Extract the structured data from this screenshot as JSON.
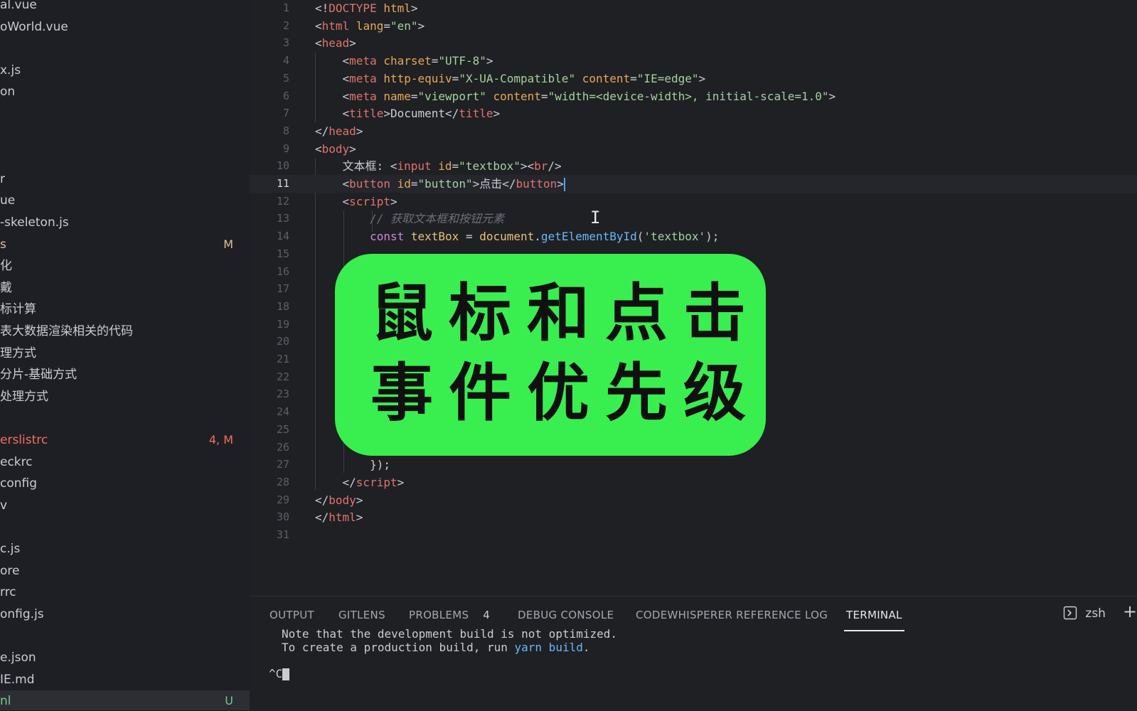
{
  "sidebar": {
    "items": [
      {
        "name": "al.vue",
        "badge": "",
        "state": ""
      },
      {
        "name": "oWorld.vue",
        "badge": "",
        "state": ""
      },
      {
        "name": "",
        "badge": "",
        "state": ""
      },
      {
        "name": "x.js",
        "badge": "",
        "state": ""
      },
      {
        "name": "on",
        "badge": "",
        "state": ""
      },
      {
        "name": "",
        "badge": "",
        "state": ""
      },
      {
        "name": "",
        "badge": "",
        "state": ""
      },
      {
        "name": "",
        "badge": "",
        "state": ""
      },
      {
        "name": "r",
        "badge": "",
        "state": ""
      },
      {
        "name": "ue",
        "badge": "",
        "state": ""
      },
      {
        "name": "-skeleton.js",
        "badge": "",
        "state": ""
      },
      {
        "name": "s",
        "badge": "M",
        "state": "mod"
      },
      {
        "name": "化",
        "badge": "",
        "state": ""
      },
      {
        "name": "戴",
        "badge": "",
        "state": ""
      },
      {
        "name": "标计算",
        "badge": "",
        "state": ""
      },
      {
        "name": "表大数据渲染相关的代码",
        "badge": "",
        "state": ""
      },
      {
        "name": "理方式",
        "badge": "",
        "state": ""
      },
      {
        "name": "分片-基础方式",
        "badge": "",
        "state": ""
      },
      {
        "name": "处理方式",
        "badge": "",
        "state": ""
      },
      {
        "name": "",
        "badge": "",
        "state": ""
      },
      {
        "name": "erslistrc",
        "badge": "4, M",
        "state": "err"
      },
      {
        "name": "eckrc",
        "badge": "",
        "state": ""
      },
      {
        "name": "config",
        "badge": "",
        "state": ""
      },
      {
        "name": "v",
        "badge": "",
        "state": ""
      },
      {
        "name": "",
        "badge": "",
        "state": ""
      },
      {
        "name": "c.js",
        "badge": "",
        "state": ""
      },
      {
        "name": "ore",
        "badge": "",
        "state": ""
      },
      {
        "name": "rrc",
        "badge": "",
        "state": ""
      },
      {
        "name": "onfig.js",
        "badge": "",
        "state": ""
      },
      {
        "name": "",
        "badge": "",
        "state": ""
      },
      {
        "name": "e.json",
        "badge": "",
        "state": ""
      },
      {
        "name": "IE.md",
        "badge": "",
        "state": ""
      },
      {
        "name": "nl",
        "badge": "U",
        "state": "untracked"
      }
    ]
  },
  "editor": {
    "active_line": 11,
    "lines": [
      {
        "n": "1",
        "tokens": [
          [
            "p",
            "<!"
          ],
          [
            "dt",
            "DOCTYPE"
          ],
          [
            "p",
            " "
          ],
          [
            "attr",
            "html"
          ],
          [
            "p",
            ">"
          ]
        ]
      },
      {
        "n": "2",
        "tokens": [
          [
            "p",
            "<"
          ],
          [
            "tag",
            "html"
          ],
          [
            "p",
            " "
          ],
          [
            "attr",
            "lang"
          ],
          [
            "p",
            "="
          ],
          [
            "str",
            "\"en\""
          ],
          [
            "p",
            ">"
          ]
        ]
      },
      {
        "n": "3",
        "tokens": [
          [
            "p",
            "<"
          ],
          [
            "tag",
            "head"
          ],
          [
            "p",
            ">"
          ]
        ]
      },
      {
        "n": "4",
        "tokens": [
          [
            "p",
            "    <"
          ],
          [
            "tag",
            "meta"
          ],
          [
            "p",
            " "
          ],
          [
            "attr",
            "charset"
          ],
          [
            "p",
            "="
          ],
          [
            "str",
            "\"UTF-8\""
          ],
          [
            "p",
            ">"
          ]
        ]
      },
      {
        "n": "5",
        "tokens": [
          [
            "p",
            "    <"
          ],
          [
            "tag",
            "meta"
          ],
          [
            "p",
            " "
          ],
          [
            "attr",
            "http-equiv"
          ],
          [
            "p",
            "="
          ],
          [
            "str",
            "\"X-UA-Compatible\""
          ],
          [
            "p",
            " "
          ],
          [
            "attr",
            "content"
          ],
          [
            "p",
            "="
          ],
          [
            "str",
            "\"IE=edge\""
          ],
          [
            "p",
            ">"
          ]
        ]
      },
      {
        "n": "6",
        "tokens": [
          [
            "p",
            "    <"
          ],
          [
            "tag",
            "meta"
          ],
          [
            "p",
            " "
          ],
          [
            "attr",
            "name"
          ],
          [
            "p",
            "="
          ],
          [
            "str",
            "\"viewport\""
          ],
          [
            "p",
            " "
          ],
          [
            "attr",
            "content"
          ],
          [
            "p",
            "="
          ],
          [
            "str",
            "\"width=<device-width>, initial-scale=1.0\""
          ],
          [
            "p",
            ">"
          ]
        ]
      },
      {
        "n": "7",
        "tokens": [
          [
            "p",
            "    <"
          ],
          [
            "tag",
            "title"
          ],
          [
            "p",
            ">"
          ],
          [
            "txt",
            "Document"
          ],
          [
            "p",
            "</"
          ],
          [
            "tag",
            "title"
          ],
          [
            "p",
            ">"
          ]
        ]
      },
      {
        "n": "8",
        "tokens": [
          [
            "p",
            "</"
          ],
          [
            "tag",
            "head"
          ],
          [
            "p",
            ">"
          ]
        ]
      },
      {
        "n": "9",
        "tokens": [
          [
            "p",
            "<"
          ],
          [
            "tag",
            "body"
          ],
          [
            "p",
            ">"
          ]
        ]
      },
      {
        "n": "10",
        "tokens": [
          [
            "txt",
            "    文本框: "
          ],
          [
            "p",
            "<"
          ],
          [
            "tag",
            "input"
          ],
          [
            "p",
            " "
          ],
          [
            "attr",
            "id"
          ],
          [
            "p",
            "="
          ],
          [
            "str",
            "\"textbox\""
          ],
          [
            "p",
            ">"
          ],
          [
            "p",
            "<"
          ],
          [
            "tag",
            "br"
          ],
          [
            "p",
            "/>"
          ]
        ]
      },
      {
        "n": "11",
        "tokens": [
          [
            "p",
            "    <"
          ],
          [
            "tag",
            "button"
          ],
          [
            "p",
            " "
          ],
          [
            "attr",
            "id"
          ],
          [
            "p",
            "="
          ],
          [
            "str",
            "\"button\""
          ],
          [
            "p",
            ">"
          ],
          [
            "txt",
            "点击"
          ],
          [
            "p",
            "</"
          ],
          [
            "tag",
            "button"
          ],
          [
            "p",
            ">"
          ]
        ]
      },
      {
        "n": "12",
        "tokens": [
          [
            "p",
            "    <"
          ],
          [
            "tag",
            "script"
          ],
          [
            "p",
            ">"
          ]
        ]
      },
      {
        "n": "13",
        "tokens": [
          [
            "com",
            "        // 获取文本框和按钮元素"
          ]
        ]
      },
      {
        "n": "14",
        "tokens": [
          [
            "kw",
            "        const"
          ],
          [
            "p",
            " "
          ],
          [
            "var",
            "textBox"
          ],
          [
            "p",
            " = "
          ],
          [
            "var",
            "document"
          ],
          [
            "p",
            "."
          ],
          [
            "fn",
            "getElementById"
          ],
          [
            "p",
            "("
          ],
          [
            "str",
            "'textbox'"
          ],
          [
            "p",
            ");"
          ]
        ]
      },
      {
        "n": "15",
        "tokens": []
      },
      {
        "n": "16",
        "tokens": []
      },
      {
        "n": "17",
        "tokens": []
      },
      {
        "n": "18",
        "tokens": []
      },
      {
        "n": "19",
        "tokens": []
      },
      {
        "n": "20",
        "tokens": []
      },
      {
        "n": "21",
        "tokens": []
      },
      {
        "n": "22",
        "tokens": []
      },
      {
        "n": "23",
        "tokens": []
      },
      {
        "n": "24",
        "tokens": []
      },
      {
        "n": "25",
        "tokens": []
      },
      {
        "n": "26",
        "tokens": []
      },
      {
        "n": "27",
        "tokens": [
          [
            "p",
            "        });"
          ]
        ]
      },
      {
        "n": "28",
        "tokens": [
          [
            "p",
            "    </"
          ],
          [
            "tag",
            "script"
          ],
          [
            "p",
            ">"
          ]
        ]
      },
      {
        "n": "29",
        "tokens": [
          [
            "p",
            "</"
          ],
          [
            "tag",
            "body"
          ],
          [
            "p",
            ">"
          ]
        ]
      },
      {
        "n": "30",
        "tokens": [
          [
            "p",
            "</"
          ],
          [
            "tag",
            "html"
          ],
          [
            "p",
            ">"
          ]
        ]
      },
      {
        "n": "31",
        "tokens": []
      }
    ]
  },
  "overlay": {
    "line1": "鼠标和点击",
    "line2": "事件优先级"
  },
  "panel": {
    "tabs": {
      "output": "OUTPUT",
      "gitlens": "GITLENS",
      "problems": "PROBLEMS",
      "problems_count": "4",
      "debug": "DEBUG CONSOLE",
      "codewhisperer": "CODEWHISPERER REFERENCE LOG",
      "terminal": "TERMINAL"
    },
    "shell": "zsh",
    "terminal": {
      "line1": "Note that the development build is not optimized.",
      "line2_prefix": "To create a production build, run ",
      "line2_cmd": "yarn build",
      "line2_suffix": ".",
      "prompt": "^C"
    }
  },
  "colors": {
    "overlay_bg": "#39ee4f",
    "tag": "#e0746a",
    "attr": "#e8a75a",
    "string": "#a5d19a",
    "keyword": "#d484d8",
    "function": "#6cb6f5",
    "modified": "#e2c08d",
    "untracked": "#73c991"
  }
}
